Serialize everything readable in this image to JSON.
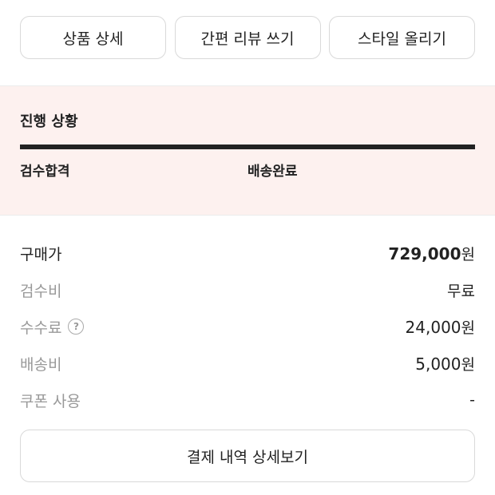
{
  "actions": {
    "product_detail": "상품 상세",
    "quick_review": "간편 리뷰 쓰기",
    "post_style": "스타일 올리기"
  },
  "progress": {
    "title": "진행 상황",
    "steps": [
      "검수합격",
      "배송완료"
    ],
    "completion_fraction": 1.0
  },
  "prices": {
    "purchase_price": {
      "label": "구매가",
      "amount": "729,000",
      "unit": "원"
    },
    "inspection_fee": {
      "label": "검수비",
      "value": "무료"
    },
    "commission": {
      "label": "수수료",
      "amount": "24,000",
      "unit": "원",
      "info_icon": "question-circle-icon"
    },
    "shipping_fee": {
      "label": "배송비",
      "amount": "5,000",
      "unit": "원"
    },
    "coupon": {
      "label": "쿠폰 사용",
      "value": "-"
    }
  },
  "detail_button": "결제 내역 상세보기",
  "colors": {
    "progress_bg": "#fdf1ef",
    "progress_fill": "#222222",
    "muted_label": "#999999"
  }
}
